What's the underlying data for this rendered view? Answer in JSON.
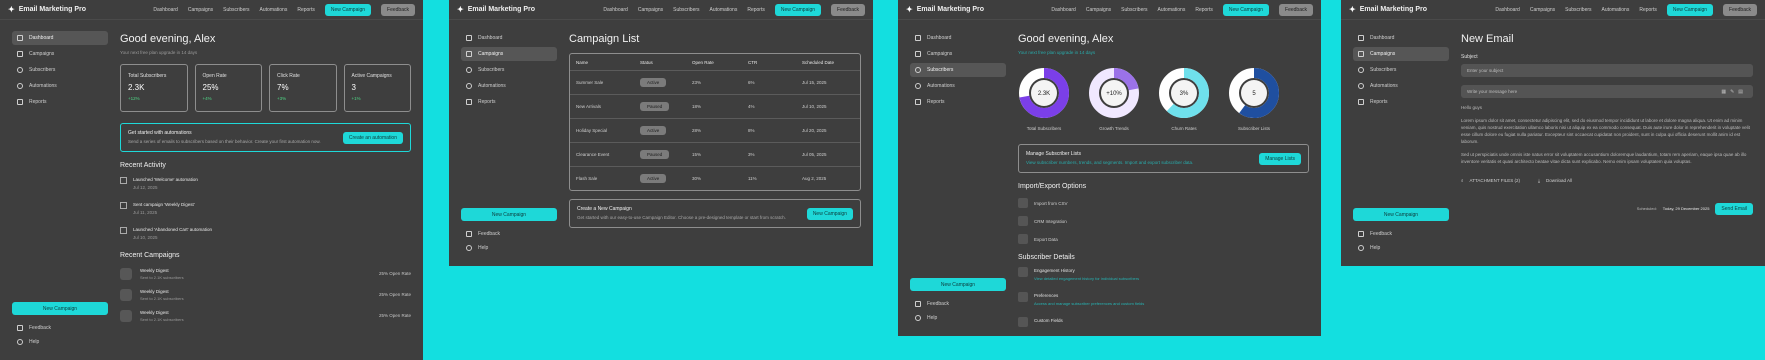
{
  "app": {
    "name": "Email Marketing Pro"
  },
  "nav": {
    "dashboard": "Dashboard",
    "campaigns": "Campaigns",
    "subscribers": "Subscribers",
    "automations": "Automations",
    "reports": "Reports",
    "new_campaign": "New Campaign",
    "feedback": "Feedback"
  },
  "sidebar": {
    "items": [
      {
        "label": "Dashboard",
        "icon": "grid-icon"
      },
      {
        "label": "Campaigns",
        "icon": "mail-icon"
      },
      {
        "label": "Subscribers",
        "icon": "users-icon"
      },
      {
        "label": "Automations",
        "icon": "gear-icon"
      },
      {
        "label": "Reports",
        "icon": "document-icon"
      }
    ],
    "cta": "New Campaign",
    "feedback": "Feedback",
    "help": "Help"
  },
  "dashboard": {
    "greeting": "Good evening, Alex",
    "subtitle": "Your next free plan upgrade in 14 days",
    "stats": [
      {
        "label": "Total Subscribers",
        "value": "2.3K",
        "delta": "+12%"
      },
      {
        "label": "Open Rate",
        "value": "25%",
        "delta": "+4%"
      },
      {
        "label": "Click Rate",
        "value": "7%",
        "delta": "+3%"
      },
      {
        "label": "Active Campaigns",
        "value": "3",
        "delta": "+1%"
      }
    ],
    "automation": {
      "title": "Get started with automations",
      "body": "Send a series of emails to subscribers based on their behavior. Create your first automation now.",
      "button": "Create an automation"
    },
    "recent_activity_title": "Recent Activity",
    "activity": [
      {
        "title": "Launched 'Welcome' automation",
        "date": "Jul 12, 2025"
      },
      {
        "title": "Sent campaign 'Weekly Digest'",
        "date": "Jul 11, 2025"
      },
      {
        "title": "Launched 'Abandoned Cart' automation",
        "date": "Jul 10, 2025"
      }
    ],
    "recent_campaigns_title": "Recent Campaigns",
    "campaigns": [
      {
        "name": "Weekly Digest",
        "meta": "Sent to 2.1K subscribers",
        "rate": "25% Open Rate"
      },
      {
        "name": "Weekly Digest",
        "meta": "Sent to 2.1K subscribers",
        "rate": "25% Open Rate"
      },
      {
        "name": "Weekly Digest",
        "meta": "Sent to 2.1K subscribers",
        "rate": "25% Open Rate"
      }
    ]
  },
  "campaign_list": {
    "title": "Campaign List",
    "headers": [
      "Name",
      "Status",
      "Open Rate",
      "CTR",
      "Scheduled Date"
    ],
    "rows": [
      [
        "Summer Sale",
        "Active",
        "23%",
        "6%",
        "Jul 15, 2025"
      ],
      [
        "New Arrivals",
        "Paused",
        "18%",
        "4%",
        "Jul 10, 2025"
      ],
      [
        "Holiday Special",
        "Active",
        "28%",
        "8%",
        "Jul 20, 2025"
      ],
      [
        "Clearance Event",
        "Paused",
        "15%",
        "3%",
        "Jul 05, 2025"
      ],
      [
        "Flash Sale",
        "Active",
        "30%",
        "11%",
        "Aug 2, 2025"
      ]
    ],
    "create": {
      "title": "Create a New Campaign",
      "body": "Get started with our easy-to-use Campaign Editor. Choose a pre-designed template or start from scratch.",
      "button": "New Campaign"
    }
  },
  "subscribers_page": {
    "greeting": "Good evening, Alex",
    "subtitle": "Your next free plan upgrade in 14 days",
    "donuts": [
      {
        "value": "2.3K",
        "label": "Total Subscribers",
        "fraction": 0.72,
        "color": "#7b3fe8",
        "track": "#ffffff"
      },
      {
        "value": "+10%",
        "label": "Growth Trends",
        "fraction": 0.22,
        "color": "#9b72e8",
        "track": "#f0e8ff"
      },
      {
        "value": "3%",
        "label": "Churn Rates",
        "fraction": 0.62,
        "color": "#6fe0ec",
        "track": "#ffffff"
      },
      {
        "value": "5",
        "label": "Subscriber Lists",
        "fraction": 0.6,
        "color": "#1f4fa0",
        "track": "#ffffff"
      }
    ],
    "manage": {
      "title": "Manage Subscriber Lists",
      "body": "View subscriber numbers, trends, and segments. Import and export subscriber data.",
      "button": "Manage Lists"
    },
    "import_title": "Import/Export Options",
    "import_items": [
      "Import from CSV",
      "CRM Integration",
      "Export Data"
    ],
    "details_title": "Subscriber Details",
    "details": [
      {
        "title": "Engagement History",
        "desc": "View detailed engagement history for individual subscribers"
      },
      {
        "title": "Preferences",
        "desc": "Access and manage subscriber preferences and custom fields"
      },
      {
        "title": "Custom Fields",
        "desc": ""
      }
    ]
  },
  "new_email": {
    "title": "New Email",
    "subject_label": "Subject",
    "subject_placeholder": "Enter your subject",
    "message_placeholder": "Write your message here",
    "greeting": "Hello guys",
    "para1": "Lorem ipsum dolor sit amet, consectetur adipiscing elit, sed do eiusmod tempor incididunt ut labore et dolore magna aliqua. Ut enim ad minim veniam, quis nostrud exercitation ullamco laboris nisi ut aliquip ex ea commodo consequat. Duis aute irure dolor in reprehenderit in voluptate velit esse cillum dolore eu fugiat nulla pariatur. Excepteur sint occaecat cupidatat non proident, sunt in culpa qui officia deserunt mollit anim id est laborum.",
    "para2": "Sed ut perspiciatis unde omnis iste natus error sit voluptatem accusantium doloremque laudantium, totam rem aperiam, eaque ipsa quae ab illo inventore veritatis et quasi architecto beatae vitae dicta sunt explicabo. Nemo enim ipsam voluptatem quia voluptas.",
    "attachment": "ATTACHMENT FILES (2)",
    "download": "Download All",
    "scheduled_label": "Scheduled:",
    "scheduled_date": "Today, 29 December 2025",
    "send": "Send Email"
  }
}
